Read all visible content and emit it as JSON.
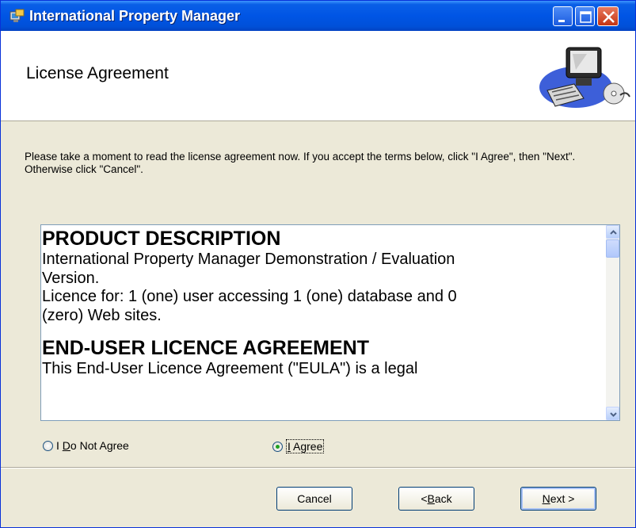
{
  "window": {
    "title": "International Property Manager",
    "minimize_icon": "minimize-icon",
    "maximize_icon": "maximize-icon",
    "close_icon": "close-icon"
  },
  "header": {
    "title": "License Agreement",
    "art_icon": "computer-installer-icon"
  },
  "instructions": "Please take a moment to read the license agreement now. If you accept the terms below, click \"I Agree\", then \"Next\". Otherwise click \"Cancel\".",
  "eula": {
    "heading1": "PRODUCT DESCRIPTION",
    "para1_line1": "International Property Manager Demonstration / Evaluation",
    "para1_line2": "Version.",
    "para1_line3": "Licence for: 1 (one) user accessing 1 (one) database and 0",
    "para1_line4": "(zero) Web sites.",
    "heading2": "END-USER LICENCE AGREEMENT",
    "para2_line1": "This End-User Licence Agreement (\"EULA\") is a legal"
  },
  "options": {
    "disagree": {
      "prefix": "I ",
      "accel": "D",
      "rest": "o Not Agree",
      "selected": false
    },
    "agree": {
      "prefix": "",
      "accel": "I",
      "rest": " Agree",
      "selected": true
    }
  },
  "buttons": {
    "cancel": "Cancel",
    "back_prefix": "< ",
    "back_accel": "B",
    "back_rest": "ack",
    "next_accel": "N",
    "next_rest": "ext >"
  },
  "colors": {
    "titlebar": "#0055e5",
    "selected_radio": "#21a121",
    "dialog_bg": "#ece9d8"
  }
}
